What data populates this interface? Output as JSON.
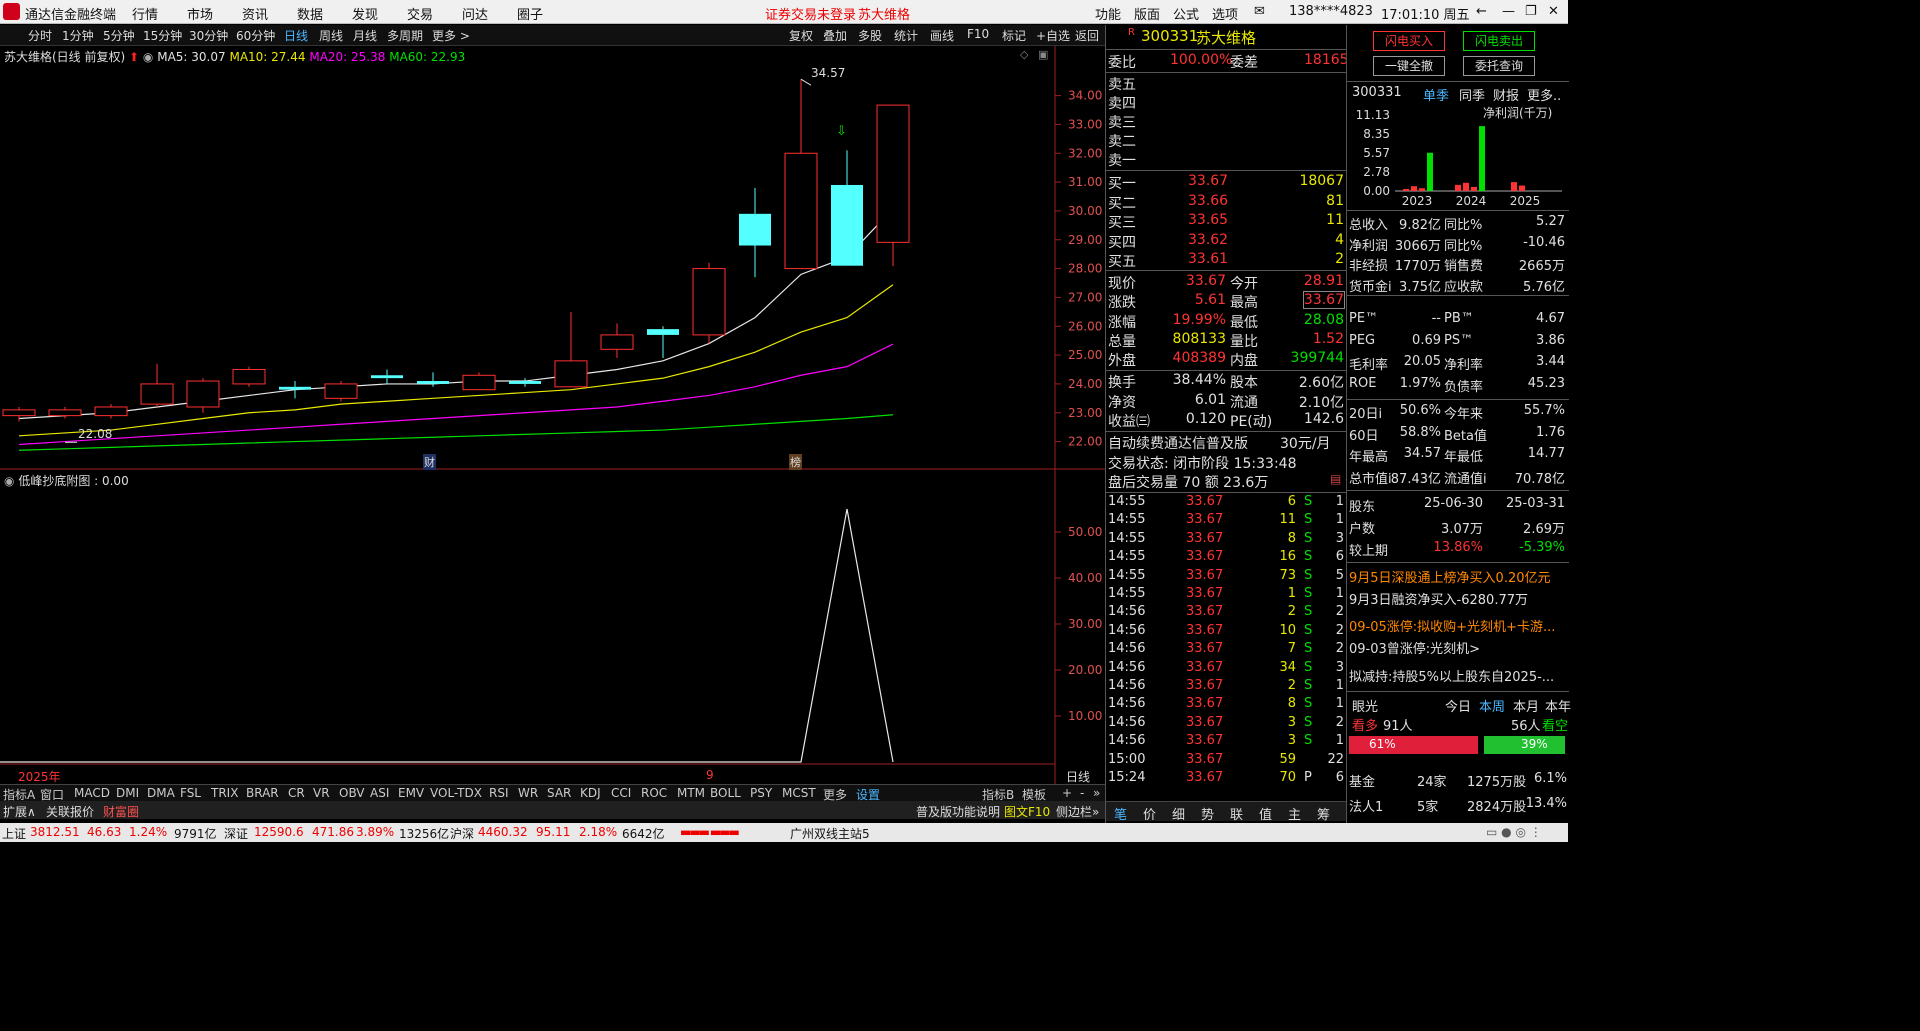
{
  "app": {
    "title": "通达信金融终端",
    "menus": [
      "行情",
      "市场",
      "资讯",
      "数据",
      "发现",
      "交易",
      "问达",
      "圈子"
    ],
    "notice": "证券交易未登录",
    "stock_title": "苏大维格",
    "right_menus": [
      "功能",
      "版面",
      "公式",
      "选项"
    ],
    "user": "138****4823",
    "clock": "17:01:10 周五"
  },
  "toolbar": {
    "periods": [
      "分时",
      "1分钟",
      "5分钟",
      "15分钟",
      "30分钟",
      "60分钟",
      "日线",
      "周线",
      "月线",
      "多周期",
      "更多 >"
    ],
    "right": [
      "复权",
      "叠加",
      "多股",
      "统计",
      "画线",
      "F10",
      "标记",
      "+自选",
      "返回"
    ]
  },
  "chart": {
    "header_name": "苏大维格(日线 前复权)",
    "ma5": "MA5: 30.07",
    "ma10": "MA10: 27.44",
    "ma20": "MA20: 25.38",
    "ma60": "MA60: 22.93",
    "high_label": "34.57",
    "low_label": "22.08",
    "y_ticks": [
      "34.00",
      "33.00",
      "32.00",
      "31.00",
      "30.00",
      "29.00",
      "28.00",
      "27.00",
      "26.00",
      "25.00",
      "24.00",
      "23.00",
      "22.00"
    ],
    "marker_cai": "财",
    "marker_bang": "榜",
    "sub_header": "低峰抄底附图 : 0.00",
    "sub_ticks": [
      "50.00",
      "40.00",
      "30.00",
      "20.00",
      "10.00"
    ],
    "date_left": "2025年",
    "date_mid": "9",
    "period_label": "日线"
  },
  "chart_data": {
    "type": "candlestick",
    "ylim": [
      21.5,
      35.2
    ],
    "candles": [
      {
        "o": 22.9,
        "c": 23.1,
        "h": 23.2,
        "l": 22.7
      },
      {
        "o": 22.9,
        "c": 23.1,
        "h": 23.2,
        "l": 22.8
      },
      {
        "o": 22.9,
        "c": 23.2,
        "h": 23.3,
        "l": 22.8
      },
      {
        "o": 23.3,
        "c": 24.0,
        "h": 24.7,
        "l": 23.2
      },
      {
        "o": 23.2,
        "c": 24.1,
        "h": 24.2,
        "l": 23.0
      },
      {
        "o": 24.0,
        "c": 24.5,
        "h": 24.6,
        "l": 23.9
      },
      {
        "o": 23.9,
        "c": 23.8,
        "h": 24.1,
        "l": 23.5
      },
      {
        "o": 23.5,
        "c": 24.0,
        "h": 24.1,
        "l": 23.4
      },
      {
        "o": 24.3,
        "c": 24.2,
        "h": 24.5,
        "l": 24.0
      },
      {
        "o": 24.1,
        "c": 24.0,
        "h": 24.4,
        "l": 23.9
      },
      {
        "o": 23.8,
        "c": 24.3,
        "h": 24.4,
        "l": 23.8
      },
      {
        "o": 24.1,
        "c": 24.0,
        "h": 24.2,
        "l": 23.9
      },
      {
        "o": 23.9,
        "c": 24.8,
        "h": 26.5,
        "l": 23.9
      },
      {
        "o": 25.2,
        "c": 25.7,
        "h": 26.1,
        "l": 24.9
      },
      {
        "o": 25.9,
        "c": 25.7,
        "h": 26.0,
        "l": 24.9
      },
      {
        "o": 25.7,
        "c": 28.0,
        "h": 28.2,
        "l": 25.4
      },
      {
        "o": 29.9,
        "c": 28.8,
        "h": 30.8,
        "l": 27.7
      },
      {
        "o": 28.0,
        "c": 32.0,
        "h": 34.57,
        "l": 28.0
      },
      {
        "o": 30.9,
        "c": 28.1,
        "h": 32.1,
        "l": 28.1
      },
      {
        "o": 28.91,
        "c": 33.67,
        "h": 33.67,
        "l": 28.08
      }
    ],
    "ma5": [
      22.8,
      22.9,
      23.0,
      23.2,
      23.4,
      23.6,
      23.8,
      23.9,
      24.0,
      24.0,
      24.1,
      24.1,
      24.3,
      24.5,
      24.8,
      25.4,
      26.3,
      27.8,
      28.4,
      30.07
    ],
    "ma10": [
      22.2,
      22.3,
      22.4,
      22.6,
      22.8,
      23.0,
      23.1,
      23.3,
      23.4,
      23.5,
      23.6,
      23.7,
      23.8,
      24.0,
      24.2,
      24.6,
      25.1,
      25.8,
      26.3,
      27.44
    ],
    "ma20": [
      21.9,
      22.0,
      22.1,
      22.2,
      22.3,
      22.4,
      22.5,
      22.6,
      22.7,
      22.8,
      22.9,
      23.0,
      23.1,
      23.2,
      23.4,
      23.6,
      23.9,
      24.3,
      24.6,
      25.38
    ],
    "ma60": [
      21.7,
      21.75,
      21.8,
      21.85,
      21.9,
      21.95,
      22.0,
      22.05,
      22.1,
      22.15,
      22.2,
      22.25,
      22.3,
      22.35,
      22.4,
      22.5,
      22.6,
      22.7,
      22.8,
      22.93
    ],
    "sub": [
      0,
      0,
      0,
      0,
      0,
      0,
      0,
      0,
      0,
      0,
      0,
      0,
      0,
      0,
      0,
      0,
      0,
      0,
      55,
      0
    ],
    "sub_ylim": [
      0,
      60
    ]
  },
  "quote": {
    "code": "300331",
    "name": "苏大维格",
    "weibi_label": "委比",
    "weibi": "100.00%",
    "weicha_label": "委差",
    "weicha": "18165",
    "sells": [
      "卖五",
      "卖四",
      "卖三",
      "卖二",
      "卖一"
    ],
    "buys": [
      {
        "l": "买一",
        "p": "33.67",
        "v": "18067"
      },
      {
        "l": "买二",
        "p": "33.66",
        "v": "81"
      },
      {
        "l": "买三",
        "p": "33.65",
        "v": "11"
      },
      {
        "l": "买四",
        "p": "33.62",
        "v": "4"
      },
      {
        "l": "买五",
        "p": "33.61",
        "v": "2"
      }
    ],
    "stats": [
      {
        "a": "现价",
        "b": "33.67",
        "c": "今开",
        "d": "28.91"
      },
      {
        "a": "涨跌",
        "b": "5.61",
        "c": "最高",
        "d": "33.67"
      },
      {
        "a": "涨幅",
        "b": "19.99%",
        "c": "最低",
        "d": "28.08"
      },
      {
        "a": "总量",
        "b": "808133",
        "c": "量比",
        "d": "1.52"
      },
      {
        "a": "外盘",
        "b": "408389",
        "c": "内盘",
        "d": "399744"
      }
    ],
    "stats2": [
      {
        "a": "换手",
        "b": "38.44%",
        "c": "股本",
        "d": "2.60亿"
      },
      {
        "a": "净资",
        "b": "6.01",
        "c": "流通",
        "d": "2.10亿"
      },
      {
        "a": "收益㈢",
        "b": "0.120",
        "c": "PE(动)",
        "d": "142.6"
      }
    ],
    "promo": "自动续费通达信普及版",
    "promo_price": "30元/月",
    "status": "交易状态: 闭市阶段 15:33:48",
    "after": "盘后交易量 70 额 23.6万",
    "ticks": [
      {
        "t": "14:55",
        "p": "33.67",
        "v": "6",
        "s": "S",
        "n": "1"
      },
      {
        "t": "14:55",
        "p": "33.67",
        "v": "11",
        "s": "S",
        "n": "1"
      },
      {
        "t": "14:55",
        "p": "33.67",
        "v": "8",
        "s": "S",
        "n": "3"
      },
      {
        "t": "14:55",
        "p": "33.67",
        "v": "16",
        "s": "S",
        "n": "6"
      },
      {
        "t": "14:55",
        "p": "33.67",
        "v": "73",
        "s": "S",
        "n": "5"
      },
      {
        "t": "14:55",
        "p": "33.67",
        "v": "1",
        "s": "S",
        "n": "1"
      },
      {
        "t": "14:56",
        "p": "33.67",
        "v": "2",
        "s": "S",
        "n": "2"
      },
      {
        "t": "14:56",
        "p": "33.67",
        "v": "10",
        "s": "S",
        "n": "2"
      },
      {
        "t": "14:56",
        "p": "33.67",
        "v": "7",
        "s": "S",
        "n": "2"
      },
      {
        "t": "14:56",
        "p": "33.67",
        "v": "34",
        "s": "S",
        "n": "3"
      },
      {
        "t": "14:56",
        "p": "33.67",
        "v": "2",
        "s": "S",
        "n": "1"
      },
      {
        "t": "14:56",
        "p": "33.67",
        "v": "8",
        "s": "S",
        "n": "1"
      },
      {
        "t": "14:56",
        "p": "33.67",
        "v": "3",
        "s": "S",
        "n": "2"
      },
      {
        "t": "14:56",
        "p": "33.67",
        "v": "3",
        "s": "S",
        "n": "1"
      },
      {
        "t": "15:00",
        "p": "33.67",
        "v": "59",
        "s": "",
        "n": "22"
      },
      {
        "t": "15:24",
        "p": "33.67",
        "v": "70",
        "s": "P",
        "n": "6"
      }
    ],
    "tabs": [
      "笔",
      "价",
      "细",
      "势",
      "联",
      "值",
      "主",
      "筹"
    ]
  },
  "right": {
    "btn_buy": "闪电买入",
    "btn_sell": "闪电卖出",
    "btn_cancel_all": "一键全撤",
    "btn_query": "委托查询",
    "code": "300331",
    "tabs": [
      "单季",
      "同季",
      "财报",
      "更多.."
    ],
    "chart_title": "净利润(千万)",
    "fin_ticks": [
      "11.13",
      "8.35",
      "5.57",
      "2.78",
      "0.00"
    ],
    "fin_years": [
      "2023",
      "2024",
      "2025"
    ],
    "fin_bars": [
      {
        "v": 0.3,
        "c": "#ff3333"
      },
      {
        "v": 0.7,
        "c": "#ff3333"
      },
      {
        "v": 0.4,
        "c": "#ff3333"
      },
      {
        "v": 5.6,
        "c": "#00e000"
      },
      {
        "v": 0.9,
        "c": "#ff3333"
      },
      {
        "v": 1.2,
        "c": "#ff3333"
      },
      {
        "v": 0.6,
        "c": "#ff3333"
      },
      {
        "v": 9.5,
        "c": "#00e000"
      },
      {
        "v": 1.3,
        "c": "#ff3333"
      },
      {
        "v": 0.8,
        "c": "#ff3333"
      }
    ],
    "rows1": [
      {
        "a": "总收入",
        "b": "9.82亿",
        "c": "同比%",
        "d": "5.27"
      },
      {
        "a": "净利润",
        "b": "3066万",
        "c": "同比%",
        "d": "-10.46"
      },
      {
        "a": "非经损",
        "b": "1770万",
        "c": "销售费",
        "d": "2665万"
      },
      {
        "a": "货币金i",
        "b": "3.75亿",
        "c": "应收款",
        "d": "5.76亿"
      }
    ],
    "rows2": [
      {
        "a": "PE™",
        "b": "--",
        "c": "PB™",
        "d": "4.67"
      },
      {
        "a": "PEG",
        "b": "0.69",
        "c": "PS™",
        "d": "3.86"
      },
      {
        "a": "毛利率",
        "b": "20.05",
        "c": "净利率",
        "d": "3.44"
      },
      {
        "a": "ROE",
        "b": "1.97%",
        "c": "负债率",
        "d": "45.23"
      }
    ],
    "rows3": [
      {
        "a": "20日i",
        "b": "50.6%",
        "c": "今年来",
        "d": "55.7%"
      },
      {
        "a": "60日",
        "b": "58.8%",
        "c": "Beta值",
        "d": "1.76"
      },
      {
        "a": "年最高",
        "b": "34.57",
        "c": "年最低",
        "d": "14.77"
      },
      {
        "a": "总市值i",
        "b": "87.43亿",
        "c": "流通值i",
        "d": "70.78亿"
      }
    ],
    "holders": [
      {
        "a": "股东",
        "b": "25-06-30",
        "c": "25-03-31"
      },
      {
        "a": "户数",
        "b": "3.07万",
        "c": "2.69万"
      },
      {
        "a": "较上期",
        "b": "13.86%",
        "c": "-5.39%"
      }
    ],
    "news": [
      "9月5日深股通上榜净买入0.20亿元",
      "9月3日融资净买入-6280.77万",
      "09-05涨停:拟收购+光刻机+卡游...",
      "09-03曾涨停:光刻机>",
      "拟减持:持股5%以上股东自2025-..."
    ],
    "eye": "眼光",
    "eye_tabs": [
      "今日",
      "本周",
      "本月",
      "本年"
    ],
    "bull_label": "看多",
    "bull_n": "91人",
    "bear_n": "56人",
    "bear_label": "看空",
    "bull_pct": "61%",
    "bear_pct": "39%",
    "fund": [
      {
        "a": "基金",
        "b": "24家",
        "c": "1275万股",
        "d": "6.1%"
      },
      {
        "a": "法人1",
        "b": "5家",
        "c": "2824万股",
        "d": "13.4%"
      }
    ]
  },
  "bottom": {
    "tabs": [
      "指标A",
      "窗口",
      "MACD",
      "DMI",
      "DMA",
      "FSL",
      "TRIX",
      "BRAR",
      "CR",
      "VR",
      "OBV",
      "ASI",
      "EMV",
      "VOL-TDX",
      "RSI",
      "WR",
      "SAR",
      "KDJ",
      "CCI",
      "ROC",
      "MTM",
      "BOLL",
      "PSY",
      "MCST",
      "更多",
      "设置"
    ],
    "right": [
      "指标B",
      "模板",
      "+",
      "-",
      "»"
    ],
    "row2": [
      "扩展∧",
      "关联报价",
      "财富圈"
    ],
    "row2r": [
      "普及版功能说明",
      "图文F10",
      "侧边栏»"
    ]
  },
  "status": {
    "sh_label": "上证",
    "sh": "3812.51",
    "sh_ch": "46.63",
    "sh_pct": "1.24%",
    "sh_amt": "9791亿",
    "sz_label": "深证",
    "sz": "12590.6",
    "sz_ch": "471.86",
    "sz_pct": "3.89%",
    "sz_amt": "13256亿",
    "hs_label": "沪深",
    "hs": "4460.32",
    "hs_ch": "95.11",
    "hs_pct": "2.18%",
    "hs_amt": "6642亿",
    "server": "广州双线主站5"
  }
}
